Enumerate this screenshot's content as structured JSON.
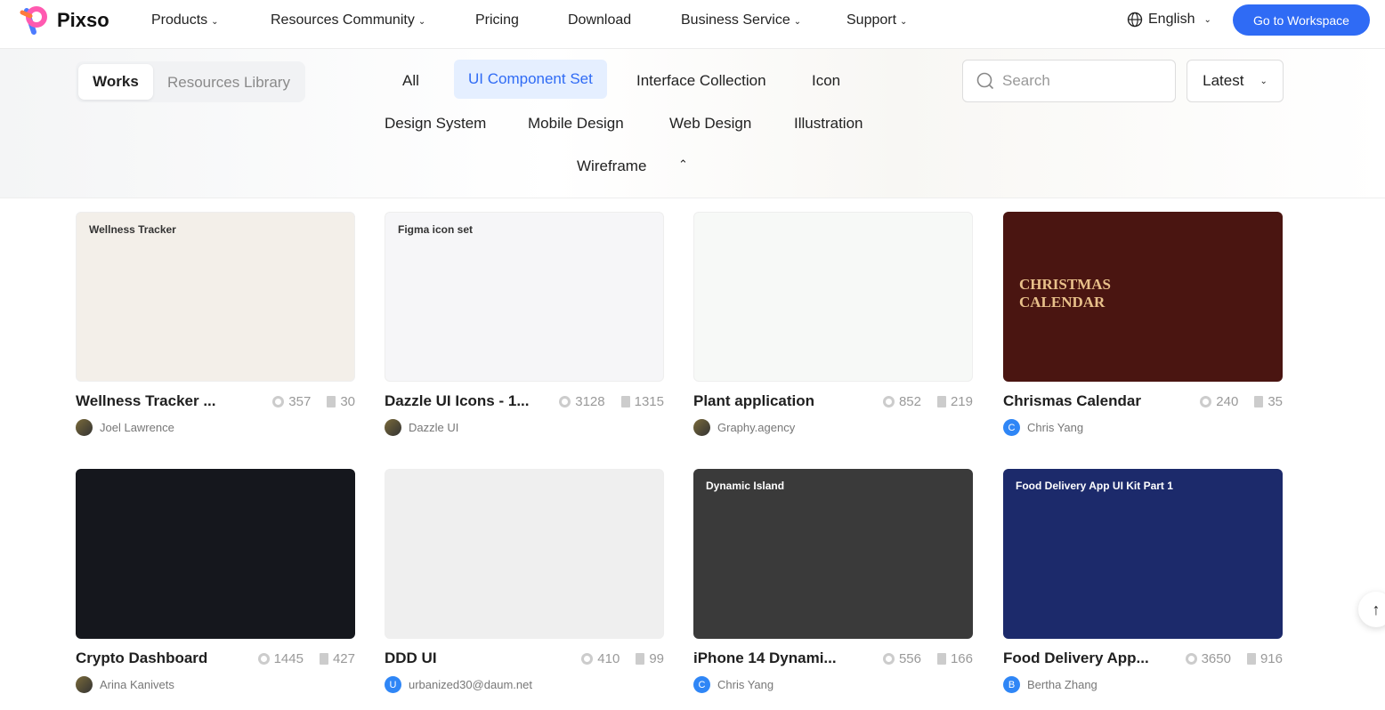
{
  "header": {
    "brand": "Pixso",
    "nav": [
      {
        "label": "Products",
        "dropdown": true
      },
      {
        "label": "Resources Community",
        "dropdown": true
      },
      {
        "label": "Pricing",
        "dropdown": false
      },
      {
        "label": "Download",
        "dropdown": false
      },
      {
        "label": "Business Service",
        "dropdown": true
      },
      {
        "label": "Support",
        "dropdown": true
      }
    ],
    "language": "English",
    "cta": "Go to Workspace"
  },
  "filter": {
    "tabs": [
      "Works",
      "Resources Library"
    ],
    "categories": [
      "All",
      "UI Component Set",
      "Interface Collection",
      "Icon",
      "Design System",
      "Mobile Design",
      "Web Design",
      "Illustration",
      "Wireframe"
    ],
    "selected": "UI Component Set",
    "search_placeholder": "Search",
    "sort": "Latest"
  },
  "colors": {
    "accent": "#2f6bf5"
  },
  "cards": [
    {
      "title": "Wellness Tracker ...",
      "views": "357",
      "dups": "30",
      "author": "Joel Lawrence",
      "avatar": "",
      "thumb_text": "Wellness Tracker",
      "bg": "#f3efe9"
    },
    {
      "title": "Dazzle UI Icons - 1...",
      "views": "3128",
      "dups": "1315",
      "author": "Dazzle UI",
      "avatar": "",
      "thumb_text": "Figma icon set",
      "bg": "#f6f6f8"
    },
    {
      "title": "Plant application",
      "views": "852",
      "dups": "219",
      "author": "Graphy.agency",
      "avatar": "",
      "thumb_text": "",
      "bg": "#f7f9f7"
    },
    {
      "title": "Chrismas Calendar",
      "views": "240",
      "dups": "35",
      "author": "Chris Yang",
      "avatar": "C",
      "thumb_text": "CHRISTMAS CALENDAR",
      "bg": "#4a1511"
    },
    {
      "title": "Crypto Dashboard",
      "views": "1445",
      "dups": "427",
      "author": "Arina Kanivets",
      "avatar": "",
      "thumb_text": "",
      "bg": "#15171d"
    },
    {
      "title": "DDD UI",
      "views": "410",
      "dups": "99",
      "author": "urbanized30@daum.net",
      "avatar": "U",
      "thumb_text": "",
      "bg": "#efefef"
    },
    {
      "title": "iPhone 14 Dynami...",
      "views": "556",
      "dups": "166",
      "author": "Chris Yang",
      "avatar": "C",
      "thumb_text": "Dynamic Island",
      "bg": "#3a3a3a"
    },
    {
      "title": "Food Delivery App...",
      "views": "3650",
      "dups": "916",
      "author": "Bertha Zhang",
      "avatar": "B",
      "thumb_text": "Food Delivery App UI Kit Part 1",
      "bg": "#1c2a6b"
    }
  ]
}
